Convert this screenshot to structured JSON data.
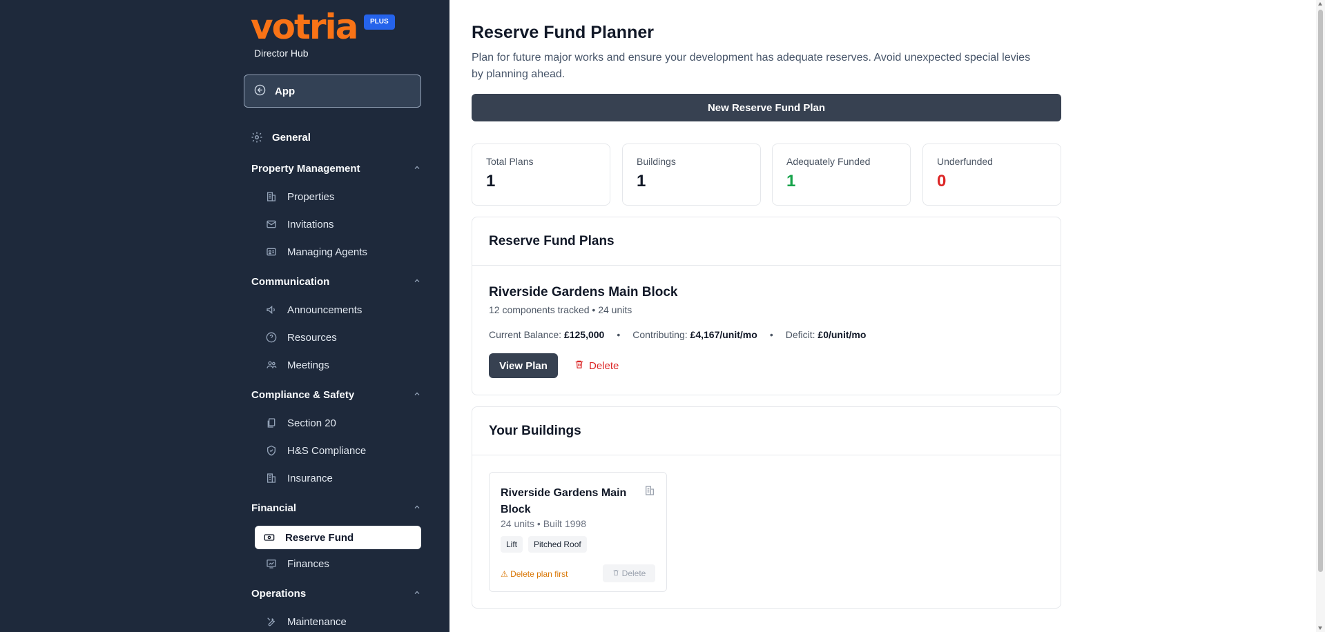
{
  "brand": {
    "logo": "votria",
    "badge": "PLUS",
    "subtitle": "Director Hub",
    "logo_color": "#f97316",
    "badge_color": "#2563eb"
  },
  "sidebar": {
    "app_button": {
      "label": "App",
      "icon": "back-arrow-circle-icon"
    },
    "general": {
      "label": "General",
      "icon": "gear-icon"
    },
    "sections": [
      {
        "title": "Property Management",
        "items": [
          {
            "label": "Properties",
            "icon": "building-icon"
          },
          {
            "label": "Invitations",
            "icon": "mail-icon"
          },
          {
            "label": "Managing Agents",
            "icon": "id-card-icon"
          }
        ]
      },
      {
        "title": "Communication",
        "items": [
          {
            "label": "Announcements",
            "icon": "megaphone-icon"
          },
          {
            "label": "Resources",
            "icon": "help-circle-icon"
          },
          {
            "label": "Meetings",
            "icon": "people-icon"
          }
        ]
      },
      {
        "title": "Compliance & Safety",
        "items": [
          {
            "label": "Section 20",
            "icon": "documents-icon"
          },
          {
            "label": "H&S Compliance",
            "icon": "shield-check-icon"
          },
          {
            "label": "Insurance",
            "icon": "building-icon"
          }
        ]
      },
      {
        "title": "Financial",
        "items": [
          {
            "label": "Reserve Fund",
            "icon": "banknote-icon",
            "active": true
          },
          {
            "label": "Finances",
            "icon": "chart-icon"
          }
        ]
      },
      {
        "title": "Operations",
        "items": [
          {
            "label": "Maintenance",
            "icon": "tools-icon"
          }
        ]
      }
    ]
  },
  "main": {
    "title": "Reserve Fund Planner",
    "description": "Plan for future major works and ensure your development has adequate reserves. Avoid unexpected special levies by planning ahead.",
    "new_plan_button": "New Reserve Fund Plan",
    "stats": [
      {
        "label": "Total Plans",
        "value": "1",
        "tone": "default"
      },
      {
        "label": "Buildings",
        "value": "1",
        "tone": "default"
      },
      {
        "label": "Adequately Funded",
        "value": "1",
        "tone": "green"
      },
      {
        "label": "Underfunded",
        "value": "0",
        "tone": "red"
      }
    ],
    "plans_panel": {
      "title": "Reserve Fund Plans",
      "plan": {
        "name": "Riverside Gardens Main Block",
        "meta": "12 components tracked • 24 units",
        "balance_label": "Current Balance:",
        "balance_value": "£125,000",
        "contributing_label": "Contributing:",
        "contributing_value": "£4,167/unit/mo",
        "deficit_label": "Deficit:",
        "deficit_value": "£0/unit/mo",
        "separator": "•",
        "view_button": "View Plan",
        "delete_button": "Delete"
      }
    },
    "buildings_panel": {
      "title": "Your Buildings",
      "building": {
        "name": "Riverside Gardens Main Block",
        "meta": "24 units • Built 1998",
        "tags": [
          "Lift",
          "Pitched Roof"
        ],
        "warning": "⚠ Delete plan first",
        "delete_button": "Delete"
      }
    }
  },
  "colors": {
    "sidebar_bg": "#1e293b",
    "primary_dark": "#374151",
    "success": "#16a34a",
    "danger": "#dc2626",
    "warning": "#d97706"
  }
}
